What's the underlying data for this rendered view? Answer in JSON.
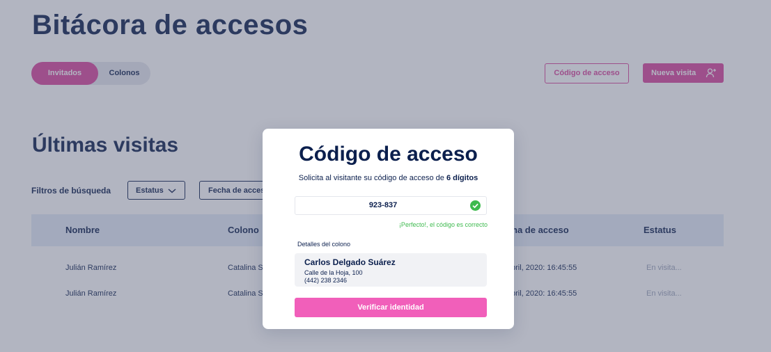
{
  "page": {
    "title": "Bitácora de accesos"
  },
  "segmented": {
    "invitados": "Invitados",
    "colonos": "Colonos"
  },
  "actions": {
    "access_code": "Código de acceso",
    "new_visit": "Nueva visita"
  },
  "section": {
    "title": "Últimas visitas"
  },
  "filters": {
    "label": "Filtros de búsqueda",
    "status": "Estatus",
    "date": "Fecha de acces"
  },
  "table": {
    "headers": [
      "Nombre",
      "Colono",
      "ha de acceso",
      "Estatus"
    ],
    "rows": [
      {
        "nombre": "Julián Ramírez",
        "colono": "Catalina S",
        "fecha": "bril, 2020: 16:45:55",
        "estatus": "En visita..."
      },
      {
        "nombre": "Julián Ramírez",
        "colono": "Catalina S",
        "fecha": "bril, 2020: 16:45:55",
        "estatus": "En visita..."
      }
    ]
  },
  "modal": {
    "title": "Código de acceso",
    "subtitle_prefix": "Solicita al visitante su código de acceso de ",
    "subtitle_bold": "6 dígitos",
    "code_value": "923-837",
    "success_message": "¡Perfecto!, el código es correcto",
    "details_label": "Detalles del colono",
    "resident": {
      "name": "Carlos Delgado Suárez",
      "address": "Calle de la Hoja, 100",
      "phone": "(442) 238 2346"
    },
    "verify_button": "Verificar identidad"
  },
  "colors": {
    "primary": "#d9469d",
    "primary_light": "#f15fba",
    "navy": "#0b1f4d",
    "success": "#3dba4e",
    "table_header": "#e3ebf7"
  },
  "icons": [
    "add-user-icon",
    "chevron-down-icon",
    "check-circle-icon"
  ]
}
